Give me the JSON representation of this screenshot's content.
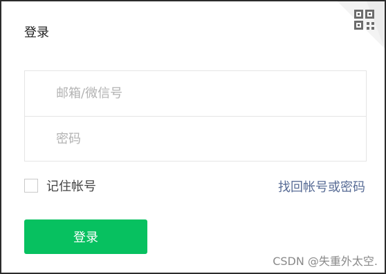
{
  "dialog": {
    "title": "登录"
  },
  "qr_switch": {
    "icon": "qr-code-icon",
    "fold_color": "#e8e8e8",
    "icon_color": "#666666"
  },
  "form": {
    "account_placeholder": "邮箱/微信号",
    "account_value": "",
    "password_placeholder": "密码",
    "password_value": ""
  },
  "options": {
    "remember_label": "记住帐号",
    "remember_checked": false,
    "find_account_link": "找回帐号或密码"
  },
  "actions": {
    "login_button": "登录",
    "login_color": "#07c160"
  },
  "watermark": "CSDN @失重外太空."
}
